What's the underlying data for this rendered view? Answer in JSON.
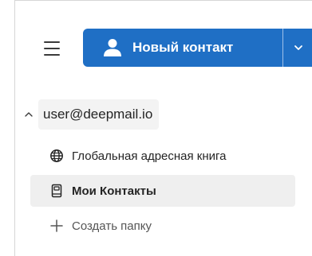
{
  "toolbar": {
    "menu_icon": "hamburger-icon",
    "new_contact_label": "Новый контакт",
    "new_contact_icon": "person-icon",
    "dropdown_icon": "chevron-down-icon",
    "accent_color": "#1f6fc5"
  },
  "account": {
    "email": "user@deepmail.io",
    "expanded": true,
    "chevron_icon": "chevron-up-icon"
  },
  "folders": [
    {
      "label": "Глобальная адресная книга",
      "icon": "globe-icon",
      "selected": false
    },
    {
      "label": "Мои Контакты",
      "icon": "address-book-icon",
      "selected": true
    },
    {
      "label": "Создать папку",
      "icon": "plus-icon",
      "selected": false
    }
  ]
}
